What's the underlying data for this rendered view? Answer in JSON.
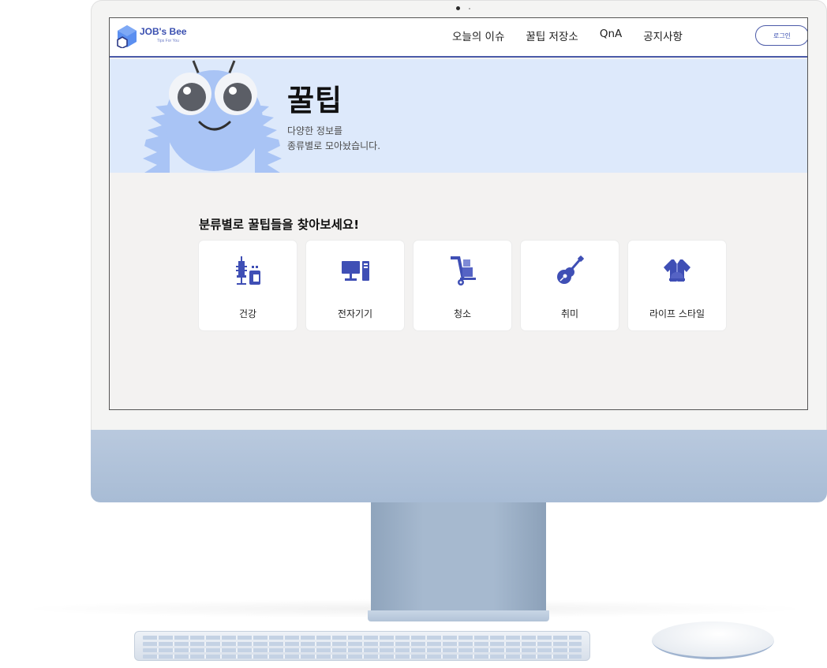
{
  "nav": {
    "logo_title": "JOB's Bee",
    "logo_sub": "Tips For You",
    "items": [
      {
        "label": "오늘의 이슈"
      },
      {
        "label": "꿀팁 저장소"
      },
      {
        "label": "QnA"
      },
      {
        "label": "공지사항"
      }
    ],
    "login_label": "로그인"
  },
  "hero": {
    "title": "꿀팁",
    "subtitle_line1": "다양한 정보를",
    "subtitle_line2": "종류별로 모아놨습니다."
  },
  "categories": {
    "heading": "분류별로 꿀팁들을 찾아보세요!",
    "items": [
      {
        "label": "건강",
        "icon": "syringe-medicine-icon"
      },
      {
        "label": "전자기기",
        "icon": "computer-icon"
      },
      {
        "label": "청소",
        "icon": "hand-truck-icon"
      },
      {
        "label": "취미",
        "icon": "guitar-icon"
      },
      {
        "label": "라이프 스타일",
        "icon": "clothes-icon"
      }
    ]
  },
  "colors": {
    "accent": "#4b5aa8",
    "icon_blue": "#3f4fb5",
    "hero_bg": "#dde9fb",
    "mascot_body": "#a9c4f5"
  }
}
